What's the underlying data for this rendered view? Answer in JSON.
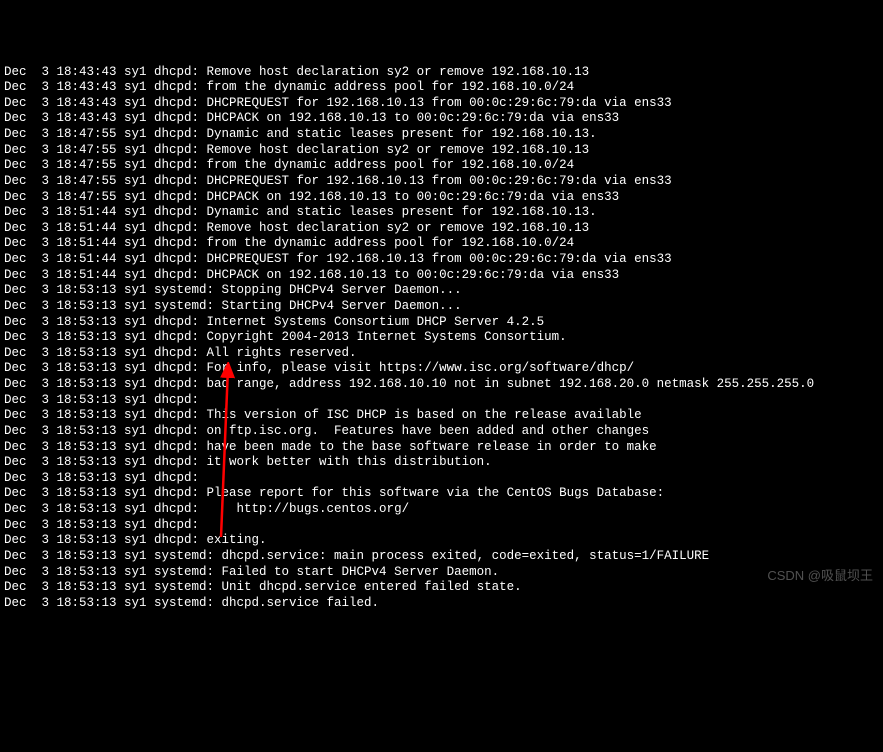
{
  "watermark": "CSDN @吸鼠坝王",
  "lines": [
    "Dec  3 18:43:43 sy1 dhcpd: Remove host declaration sy2 or remove 192.168.10.13",
    "Dec  3 18:43:43 sy1 dhcpd: from the dynamic address pool for 192.168.10.0/24",
    "Dec  3 18:43:43 sy1 dhcpd: DHCPREQUEST for 192.168.10.13 from 00:0c:29:6c:79:da via ens33",
    "Dec  3 18:43:43 sy1 dhcpd: DHCPACK on 192.168.10.13 to 00:0c:29:6c:79:da via ens33",
    "Dec  3 18:47:55 sy1 dhcpd: Dynamic and static leases present for 192.168.10.13.",
    "Dec  3 18:47:55 sy1 dhcpd: Remove host declaration sy2 or remove 192.168.10.13",
    "Dec  3 18:47:55 sy1 dhcpd: from the dynamic address pool for 192.168.10.0/24",
    "Dec  3 18:47:55 sy1 dhcpd: DHCPREQUEST for 192.168.10.13 from 00:0c:29:6c:79:da via ens33",
    "Dec  3 18:47:55 sy1 dhcpd: DHCPACK on 192.168.10.13 to 00:0c:29:6c:79:da via ens33",
    "Dec  3 18:51:44 sy1 dhcpd: Dynamic and static leases present for 192.168.10.13.",
    "Dec  3 18:51:44 sy1 dhcpd: Remove host declaration sy2 or remove 192.168.10.13",
    "Dec  3 18:51:44 sy1 dhcpd: from the dynamic address pool for 192.168.10.0/24",
    "Dec  3 18:51:44 sy1 dhcpd: DHCPREQUEST for 192.168.10.13 from 00:0c:29:6c:79:da via ens33",
    "Dec  3 18:51:44 sy1 dhcpd: DHCPACK on 192.168.10.13 to 00:0c:29:6c:79:da via ens33",
    "Dec  3 18:53:13 sy1 systemd: Stopping DHCPv4 Server Daemon...",
    "Dec  3 18:53:13 sy1 systemd: Starting DHCPv4 Server Daemon...",
    "Dec  3 18:53:13 sy1 dhcpd: Internet Systems Consortium DHCP Server 4.2.5",
    "Dec  3 18:53:13 sy1 dhcpd: Copyright 2004-2013 Internet Systems Consortium.",
    "Dec  3 18:53:13 sy1 dhcpd: All rights reserved.",
    "Dec  3 18:53:13 sy1 dhcpd: For info, please visit https://www.isc.org/software/dhcp/",
    "Dec  3 18:53:13 sy1 dhcpd: bad range, address 192.168.10.10 not in subnet 192.168.20.0 netmask 255.255.255.0",
    "Dec  3 18:53:13 sy1 dhcpd: ",
    "Dec  3 18:53:13 sy1 dhcpd: This version of ISC DHCP is based on the release available",
    "Dec  3 18:53:13 sy1 dhcpd: on ftp.isc.org.  Features have been added and other changes",
    "Dec  3 18:53:13 sy1 dhcpd: have been made to the base software release in order to make",
    "Dec  3 18:53:13 sy1 dhcpd: it work better with this distribution.",
    "Dec  3 18:53:13 sy1 dhcpd: ",
    "Dec  3 18:53:13 sy1 dhcpd: Please report for this software via the CentOS Bugs Database:",
    "Dec  3 18:53:13 sy1 dhcpd:     http://bugs.centos.org/",
    "Dec  3 18:53:13 sy1 dhcpd: ",
    "Dec  3 18:53:13 sy1 dhcpd: exiting.",
    "Dec  3 18:53:13 sy1 systemd: dhcpd.service: main process exited, code=exited, status=1/FAILURE",
    "Dec  3 18:53:13 sy1 systemd: Failed to start DHCPv4 Server Daemon.",
    "Dec  3 18:53:13 sy1 systemd: Unit dhcpd.service entered failed state.",
    "Dec  3 18:53:13 sy1 systemd: dhcpd.service failed."
  ]
}
